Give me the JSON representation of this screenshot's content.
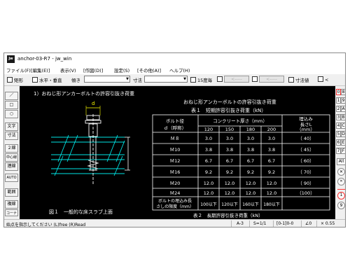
{
  "window": {
    "title": "anchor-03-R7 - jw_win",
    "icon_text": "jw"
  },
  "menu": [
    "ファイル(F)",
    "[編集(E)]",
    "表示(V)",
    "[作図(D)]",
    "設定(S)",
    "[その他(A)]",
    "ヘルプ(H)"
  ],
  "toolbar": {
    "rect_label": "矩形",
    "hv_label": "水平・垂直",
    "slope_label": "傾き",
    "dim_label": "寸法",
    "angle15_label": "15度毎",
    "arrows_left": "<-----",
    "arrows_right": "<-----",
    "dimval_label": "寸法値",
    "last_label": "<"
  },
  "left_tools": [
    "／",
    "□",
    "○",
    "文字",
    "寸法",
    "２線",
    "中心線",
    "連線",
    "AUTO",
    "範囲",
    "複線",
    "コーナー"
  ],
  "right_tools": [
    [
      "0",
      "8"
    ],
    [
      "1",
      "9"
    ],
    [
      "2",
      "A"
    ],
    [
      "3",
      "B"
    ],
    [
      "4",
      "C"
    ],
    [
      "5",
      "D"
    ],
    [
      "6",
      "E"
    ],
    [
      "7",
      "F"
    ]
  ],
  "right_extra": {
    "all_label": "All",
    "x_label": "✕",
    "circle_1": "1",
    "circle_9": "9"
  },
  "drawing": {
    "section_title": "1）おねじ形アンカーボルトの許容引抜き荷重",
    "dim_d": "d",
    "fig_caption": "図１　一般的な床スラブ上面",
    "table_title": "おねじ形アンカーボルトの許容引抜き荷重",
    "table_subtitle": "表１　短期許容引抜き荷重（kN）",
    "header_bolt_1": "ボルト径",
    "header_bolt_2": "ｄ（呼称）",
    "header_concrete": "コンクリート厚さ（mm）",
    "header_embed_1": "埋込み",
    "header_embed_2": "長さL",
    "header_embed_3": "（mm）",
    "thickness": [
      "120",
      "150",
      "180",
      "200"
    ],
    "rows": [
      {
        "bolt": "Ｍ８",
        "values": [
          "3.0",
          "3.0",
          "3.0",
          "3.0"
        ],
        "embed": "（ 40）"
      },
      {
        "bolt": "Ｍ10",
        "values": [
          "3.8",
          "3.8",
          "3.8",
          "3.8"
        ],
        "embed": "（ 45）"
      },
      {
        "bolt": "Ｍ12",
        "values": [
          "6.7",
          "6.7",
          "6.7",
          "6.7"
        ],
        "embed": "（ 60）"
      },
      {
        "bolt": "Ｍ16",
        "values": [
          "9.2",
          "9.2",
          "9.2",
          "9.2"
        ],
        "embed": "（ 70）"
      },
      {
        "bolt": "Ｍ20",
        "values": [
          "12.0",
          "12.0",
          "12.0",
          "12.0"
        ],
        "embed": "（ 90）"
      },
      {
        "bolt": "Ｍ24",
        "values": [
          "12.0",
          "12.0",
          "12.0",
          "12.0"
        ],
        "embed": "（100）"
      }
    ],
    "footer_label_1": "ボルトの埋込み長",
    "footer_label_2": "さしの限度（mm）",
    "footer_values": [
      "100以下",
      "120以下",
      "160以下",
      "180以下"
    ],
    "table2_title": "表２　長期許容引抜き荷重（kN）"
  },
  "status": {
    "message": "始点を指示してください (L)free (R)Read",
    "paper": "A-3",
    "scale": "S=1/1",
    "layer": "[0-1]0-0",
    "angle": "∠0",
    "zoom": "× 0.55"
  },
  "colors": {
    "canvas_bg": "#000000",
    "drawing_white": "#ffffff",
    "drawing_cyan": "#00e5e5",
    "drawing_yellow": "#ffff00",
    "accent_red": "#ff3333"
  }
}
